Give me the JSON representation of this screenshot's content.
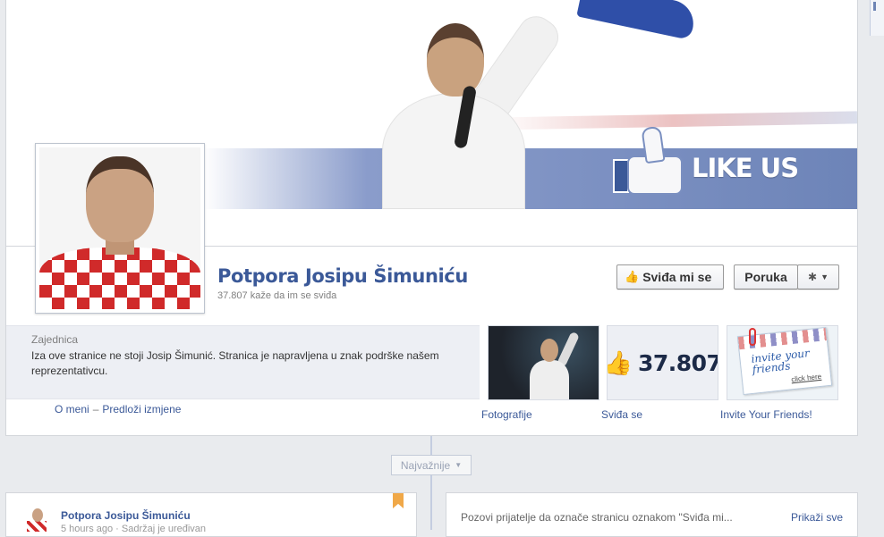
{
  "cover": {
    "like_us_text": "LIKE US"
  },
  "page": {
    "name": "Potpora Josipu Šimuniću",
    "likes_line": "37.807 kaže da im se sviđa"
  },
  "actions": {
    "like_button": "Sviđa mi se",
    "message_button": "Poruka",
    "gear_icon": "gear-icon"
  },
  "about": {
    "category": "Zajednica",
    "description": "Iza ove stranice ne stoji Josip Šimunić. Stranica je napravljena u znak podrške našem reprezentativcu.",
    "links": [
      "O meni",
      "Predloži izmjene"
    ],
    "separator": "–"
  },
  "tiles": [
    {
      "label": "Fotografije"
    },
    {
      "label": "Sviđa se",
      "count": "37.807"
    },
    {
      "label": "Invite Your Friends!",
      "card_text": "invite your friends",
      "click_text": "click here"
    }
  ],
  "timeline": {
    "filter_label": "Najvažnije",
    "post": {
      "author": "Potpora Josipu Šimuniću",
      "meta": "5 hours ago · Sadržaj je uređivan"
    },
    "side_card": {
      "text": "Pozovi prijatelje da označe stranicu oznakom \"Sviđa mi...",
      "link": "Prikaži sve"
    }
  },
  "colors": {
    "brand": "#3b5998",
    "cover_band": "#6d84b8",
    "bookmark": "#f0a848"
  }
}
